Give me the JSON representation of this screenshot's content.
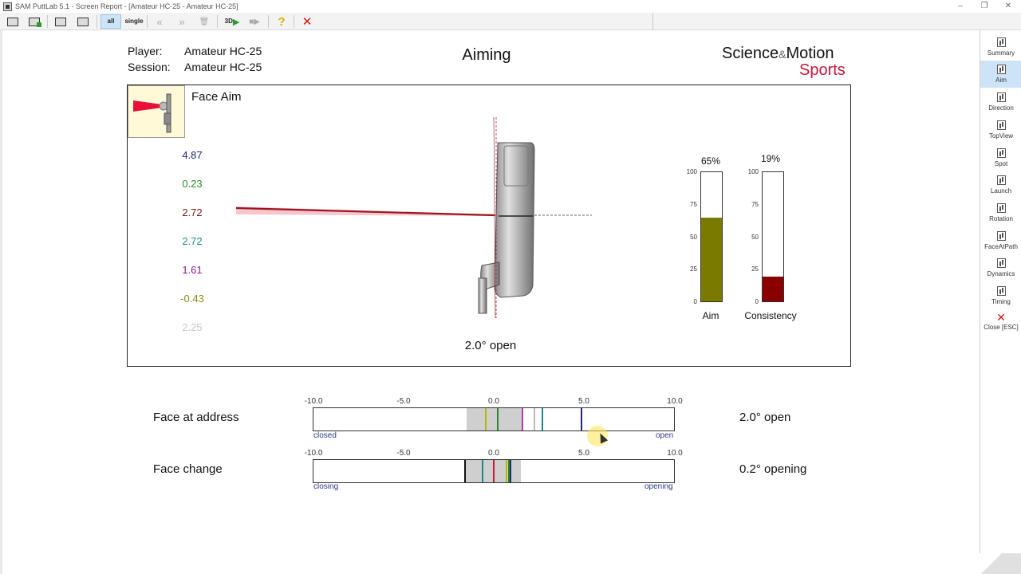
{
  "window": {
    "title": "SAM PuttLab 5.1 - Screen Report - [Amateur HC-25 - Amateur HC-25]",
    "controls": [
      "–",
      "❐",
      "✕"
    ]
  },
  "toolbar": {
    "all_label": "all",
    "single_label": "single",
    "threed_label": "3D",
    "help_label": "?",
    "close_label": "✕",
    "back_label": "«",
    "forward_label": "»",
    "trash_label": "🗑"
  },
  "nav": {
    "items": [
      {
        "label": "Summary"
      },
      {
        "label": "Aim"
      },
      {
        "label": "Direction"
      },
      {
        "label": "TopView"
      },
      {
        "label": "Spot"
      },
      {
        "label": "Launch"
      },
      {
        "label": "Rotation"
      },
      {
        "label": "FaceAtPath"
      },
      {
        "label": "Dynamics"
      },
      {
        "label": "Timing"
      },
      {
        "label": "Close [ESC]"
      }
    ],
    "active": "Aim"
  },
  "header": {
    "player_label": "Player:",
    "player_value": "Amateur HC-25",
    "session_label": "Session:",
    "session_value": "Amateur HC-25",
    "title": "Aiming",
    "brand_part1": "Science",
    "brand_amp": "&",
    "brand_part2": "Motion",
    "brand_part3": "Sports"
  },
  "face_aim": {
    "title": "Face Aim",
    "values": [
      {
        "text": "4.87",
        "color": "#1f2a7a"
      },
      {
        "text": "0.23",
        "color": "#2a8a2a"
      },
      {
        "text": "2.72",
        "color": "#7a1a1a"
      },
      {
        "text": "2.72",
        "color": "#1a8a8a"
      },
      {
        "text": "1.61",
        "color": "#8a1a8a"
      },
      {
        "text": "-0.43",
        "color": "#8a8a1a"
      },
      {
        "text": "2.25",
        "color": "#c8c8c8"
      }
    ],
    "result": "2.0° open",
    "gauges": [
      {
        "name": "Aim",
        "pct_text": "65%",
        "pct": 65,
        "color": "#7a7a00",
        "ticks": [
          "100",
          "75",
          "50",
          "25",
          "0"
        ]
      },
      {
        "name": "Consistency",
        "pct_text": "19%",
        "pct": 19,
        "color": "#8a0000",
        "ticks": [
          "100",
          "75",
          "50",
          "25",
          "0"
        ]
      }
    ]
  },
  "scales": {
    "ticks": [
      "-10.0",
      "-5.0",
      "0.0",
      "5.0",
      "10.0"
    ],
    "min": -10,
    "max": 10,
    "rows": [
      {
        "label": "Face at address",
        "result": "2.0° open",
        "left_end": "closed",
        "right_end": "open",
        "shade": [
          -1.5,
          1.6
        ],
        "marks": [
          {
            "value": -0.43,
            "color": "#b8b800"
          },
          {
            "value": 0.23,
            "color": "#2a8a2a"
          },
          {
            "value": 1.61,
            "color": "#b03ab0"
          },
          {
            "value": 2.25,
            "color": "#bbbbbb"
          },
          {
            "value": 2.72,
            "color": "#1a8a8a"
          },
          {
            "value": 4.87,
            "color": "#1f2a7a"
          }
        ]
      },
      {
        "label": "Face change",
        "result": "0.2° opening",
        "left_end": "closing",
        "right_end": "opening",
        "shade": [
          -1.6,
          1.5
        ],
        "marks": [
          {
            "value": -1.6,
            "color": "#111111"
          },
          {
            "value": -0.6,
            "color": "#1a8a8a"
          },
          {
            "value": 0.0,
            "color": "#c8163c"
          },
          {
            "value": 0.7,
            "color": "#b8b800"
          },
          {
            "value": 0.85,
            "color": "#2a8a2a"
          },
          {
            "value": 0.95,
            "color": "#1f2a7a"
          }
        ]
      }
    ]
  }
}
